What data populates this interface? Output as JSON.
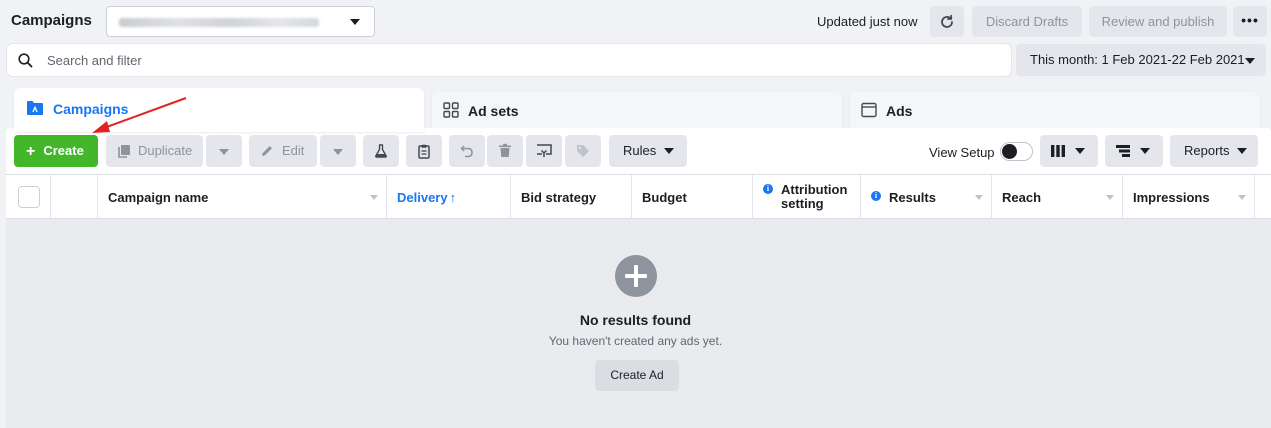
{
  "header": {
    "title": "Campaigns",
    "account_select_value": "",
    "updated_text": "Updated just now",
    "discard_label": "Discard Drafts",
    "review_label": "Review and publish",
    "more_label": "•••"
  },
  "search": {
    "placeholder": "Search and filter",
    "value": ""
  },
  "date_range": {
    "label": "This month: 1 Feb 2021-22 Feb 2021"
  },
  "tabs": [
    {
      "label": "Campaigns",
      "active": true
    },
    {
      "label": "Ad sets",
      "active": false
    },
    {
      "label": "Ads",
      "active": false
    }
  ],
  "toolbar": {
    "create_label": "Create",
    "duplicate_label": "Duplicate",
    "edit_label": "Edit",
    "rules_label": "Rules",
    "view_setup_label": "View Setup",
    "view_setup_on": false,
    "reports_label": "Reports"
  },
  "table": {
    "columns": [
      "Campaign name",
      "Delivery",
      "Bid strategy",
      "Budget",
      "Attribution setting",
      "Results",
      "Reach",
      "Impressions"
    ],
    "sorted_column": "Delivery",
    "sort_direction": "ascending"
  },
  "empty_state": {
    "title": "No results found",
    "subtitle": "You haven't created any ads yet.",
    "button_label": "Create Ad"
  },
  "colors": {
    "accent": "#1877f2",
    "create_green": "#42b72a",
    "annotation_arrow": "#e02424"
  }
}
